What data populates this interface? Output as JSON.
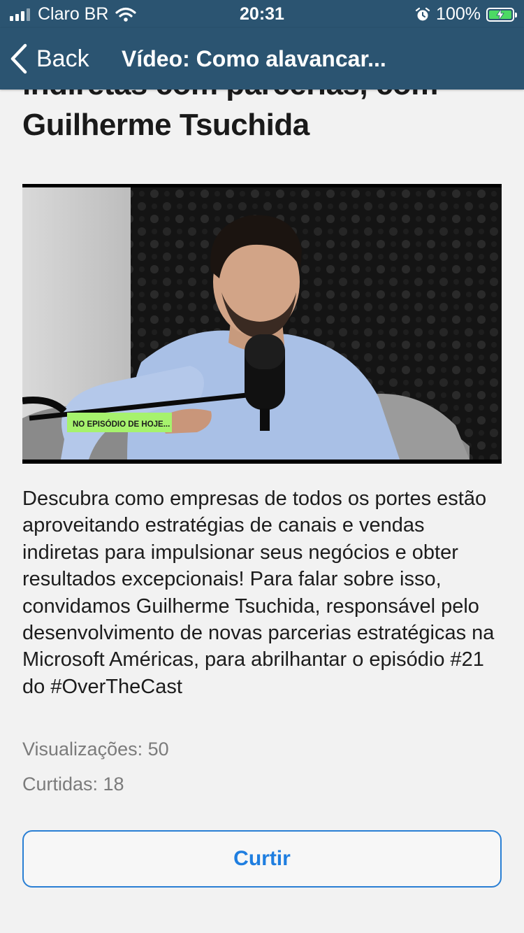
{
  "status_bar": {
    "carrier": "Claro BR",
    "time": "20:31",
    "battery_percent": "100%",
    "icons": [
      "signal-icon",
      "wifi-icon",
      "alarm-icon",
      "battery-charging-icon"
    ]
  },
  "nav": {
    "back_label": "Back",
    "title": "Vídeo: Como alavancar..."
  },
  "video": {
    "title": "indiretas com parcerias, com Guilherme Tsuchida",
    "overlay_caption": "NO EPISÓDIO DE HOJE...",
    "description": "Descubra como empresas de todos os portes estão aproveitando estratégias de canais e vendas indiretas para impulsionar seus negócios e obter resultados excepcionais! Para falar sobre isso, convidamos Guilherme Tsuchida, responsável pelo desenvolvimento de novas parcerias estratégicas na Microsoft Américas, para abrilhantar o episódio #21 do #OverTheCast",
    "views": "Visualizações: 50",
    "likes": "Curtidas: 18"
  },
  "actions": {
    "like_label": "Curtir"
  },
  "colors": {
    "header_bg": "#2b5471",
    "accent": "#1f7ee0",
    "caption_bg": "#a6f26d",
    "battery_green": "#4cd964"
  }
}
